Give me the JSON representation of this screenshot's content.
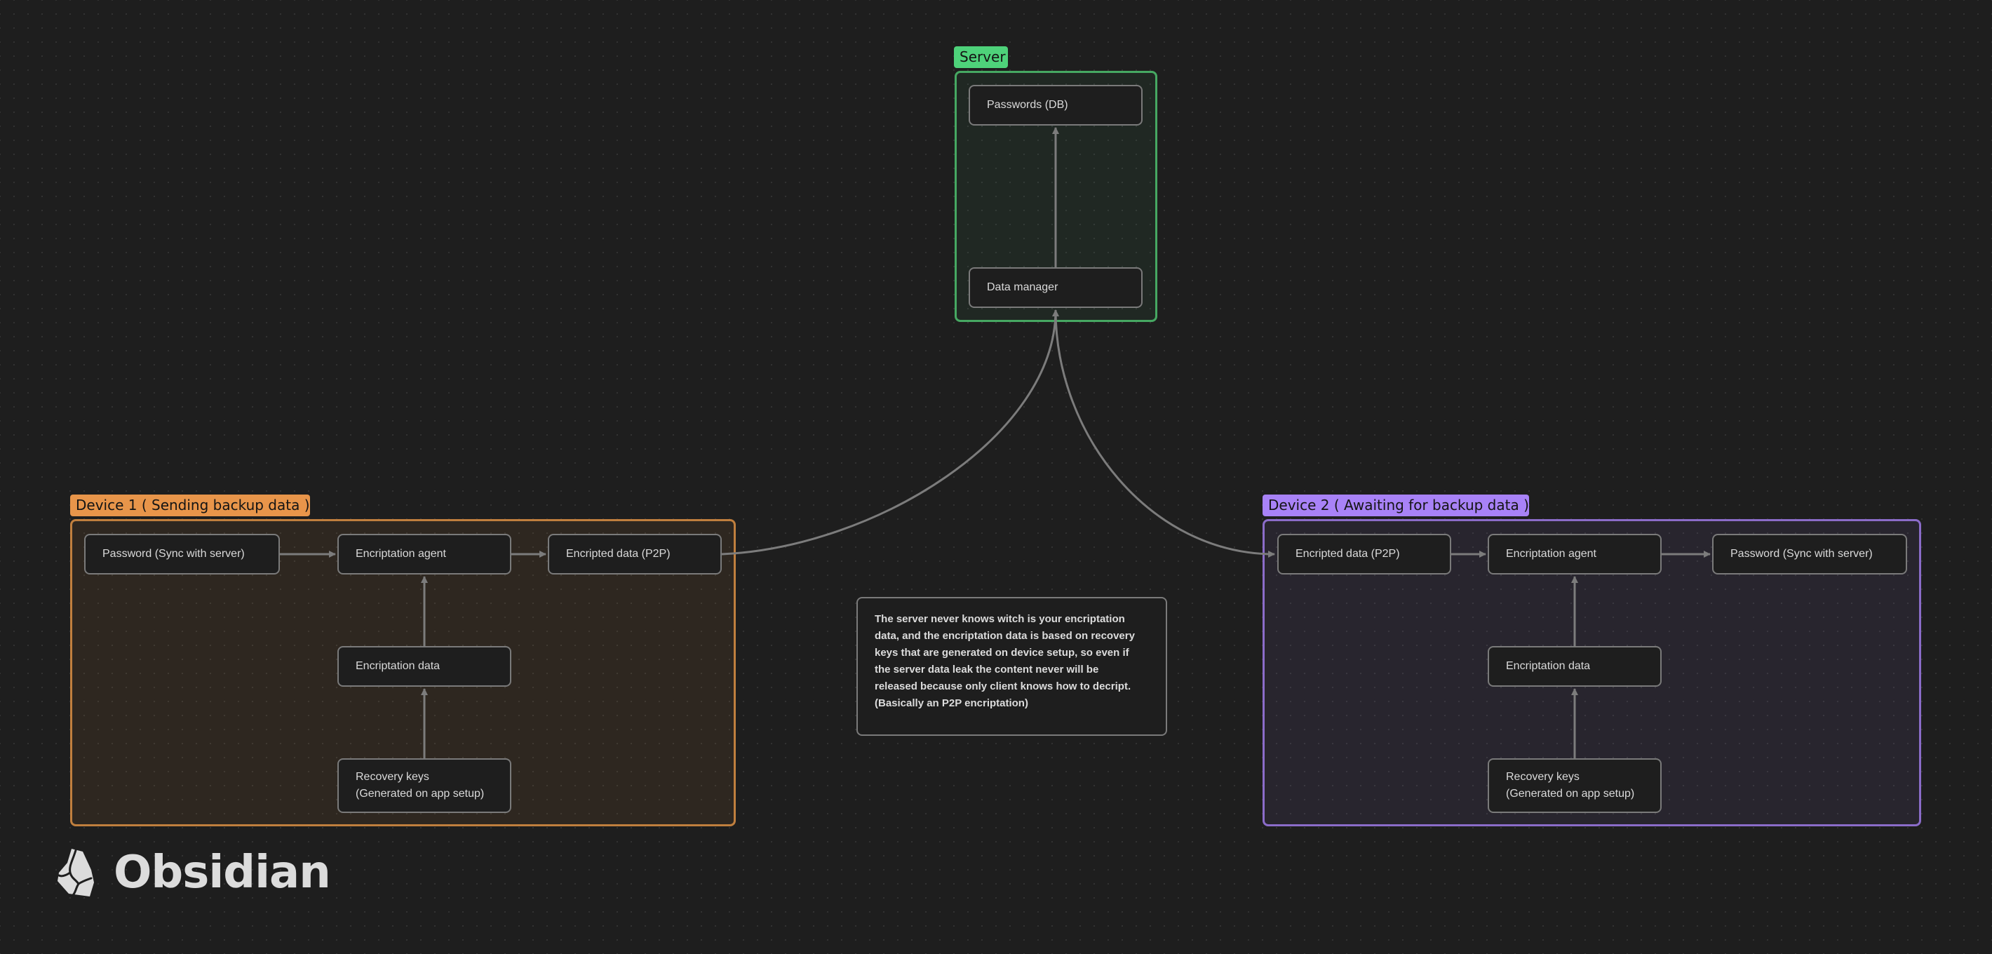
{
  "canvas": {
    "background_color": "#1e1e1e"
  },
  "groups": {
    "server": {
      "label": "Server",
      "color": "#4ed27a"
    },
    "device1": {
      "label": "Device 1 ( Sending backup data )",
      "color": "#e8954a"
    },
    "device2": {
      "label": "Device 2 ( Awaiting for backup data )",
      "color": "#a882f7"
    }
  },
  "nodes": {
    "server_passwords_db": {
      "lines": [
        "Passwords (DB)"
      ]
    },
    "server_data_manager": {
      "lines": [
        "Data manager"
      ]
    },
    "dev1_password": {
      "lines": [
        "Password (Sync with server)"
      ]
    },
    "dev1_agent": {
      "lines": [
        "Encriptation agent"
      ]
    },
    "dev1_encripted": {
      "lines": [
        "Encripted data (P2P)"
      ]
    },
    "dev1_enc_data": {
      "lines": [
        "Encriptation data"
      ]
    },
    "dev1_recovery": {
      "lines": [
        "Recovery keys",
        "(Generated on app setup)"
      ]
    },
    "dev2_encripted": {
      "lines": [
        "Encripted data (P2P)"
      ]
    },
    "dev2_agent": {
      "lines": [
        "Encriptation agent"
      ]
    },
    "dev2_password": {
      "lines": [
        "Password (Sync with server)"
      ]
    },
    "dev2_enc_data": {
      "lines": [
        "Encriptation data"
      ]
    },
    "dev2_recovery": {
      "lines": [
        "Recovery keys",
        "(Generated on app setup)"
      ]
    }
  },
  "note": {
    "lines": [
      "The server never knows witch is your encriptation",
      "data, and the encriptation data is based on recovery",
      "keys that are generated on device setup, so even if",
      "the server data leak the content never will be",
      "released because only client knows how to decript.",
      "(Basically an P2P encriptation)"
    ]
  },
  "edges": [
    {
      "from": "dev1_password",
      "to": "dev1_agent"
    },
    {
      "from": "dev1_agent",
      "to": "dev1_encripted"
    },
    {
      "from": "dev1_enc_data",
      "to": "dev1_agent"
    },
    {
      "from": "dev1_recovery",
      "to": "dev1_enc_data"
    },
    {
      "from": "dev1_encripted",
      "to": "server_data_manager"
    },
    {
      "from": "server_data_manager",
      "to": "server_passwords_db"
    },
    {
      "from": "server_data_manager",
      "to": "dev2_encripted"
    },
    {
      "from": "dev2_encripted",
      "to": "dev2_agent"
    },
    {
      "from": "dev2_agent",
      "to": "dev2_password"
    },
    {
      "from": "dev2_enc_data",
      "to": "dev2_agent"
    },
    {
      "from": "dev2_recovery",
      "to": "dev2_enc_data"
    }
  ],
  "branding": {
    "logo_text": "Obsidian",
    "logo_icon": "obsidian-crystal-icon"
  }
}
